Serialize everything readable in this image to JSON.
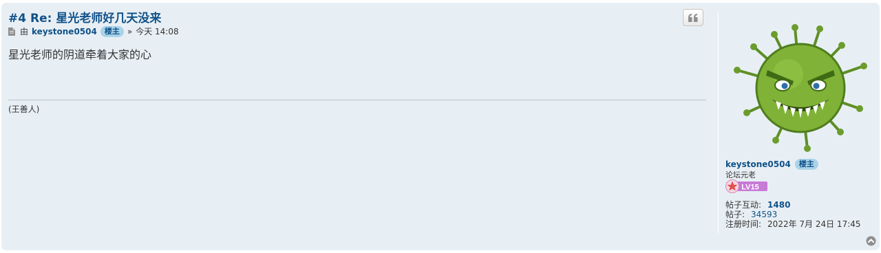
{
  "post": {
    "title": "#4 Re: 星光老师好几天没来",
    "meta": {
      "by": "由",
      "author": "keystone0504",
      "author_badge": "楼主",
      "separator": "»",
      "time": "今天 14:08"
    },
    "content": "星光老师的阴道牵着大家的心",
    "signature": "(王善人)"
  },
  "profile": {
    "username": "keystone0504",
    "badge": "楼主",
    "rank_title": "论坛元老",
    "level": "LV15",
    "stats": {
      "interaction_label": "帖子互动:",
      "interaction_value": "1480",
      "posts_label": "帖子:",
      "posts_value": "34593",
      "joined_label": "注册时间:",
      "joined_value": "2022年 7月 24日 17:45"
    }
  },
  "icons": {
    "file": "file-icon",
    "quote": "quote-icon",
    "back_to_top": "back-to-top-icon",
    "level_star": "star-icon"
  },
  "colors": {
    "panel_bg": "#e8eff4",
    "link": "#105289",
    "badge_bg": "#a9d3e8",
    "level_badge": "#c77ad6"
  }
}
